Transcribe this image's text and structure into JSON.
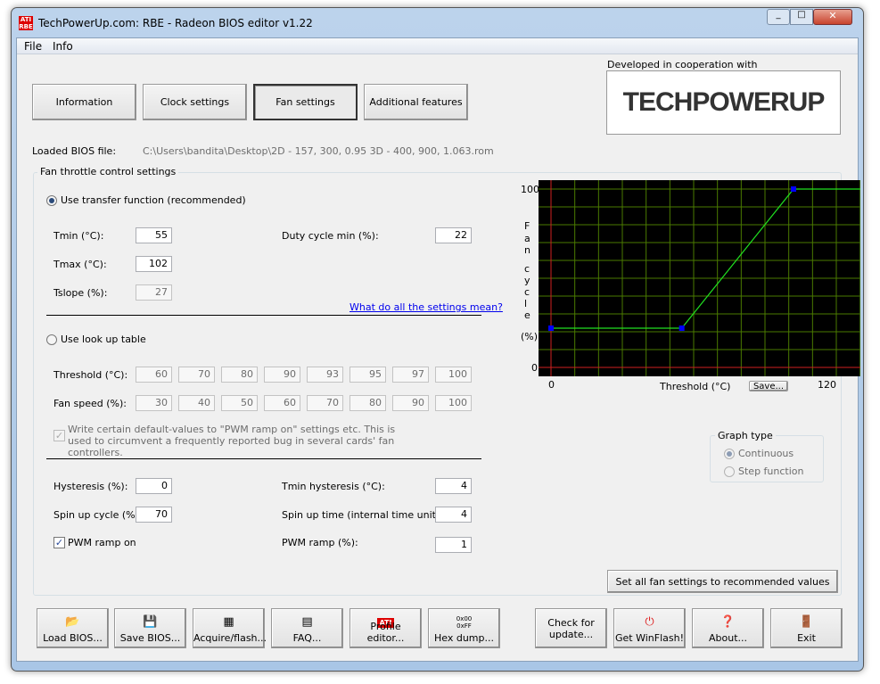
{
  "window": {
    "title": "TechPowerUp.com: RBE - Radeon BIOS editor v1.22",
    "app_icon": "ati-rbe-icon"
  },
  "menu": [
    "File",
    "Info"
  ],
  "tabs": [
    {
      "label": "Information"
    },
    {
      "label": "Clock settings"
    },
    {
      "label": "Fan settings",
      "active": true
    },
    {
      "label": "Additional features"
    }
  ],
  "sponsor": {
    "caption": "Developed in cooperation with",
    "logo_text": "TECHPOWERUP"
  },
  "bios": {
    "label": "Loaded BIOS file:",
    "path": "C:\\Users\\bandita\\Desktop\\2D - 157, 300, 0.95 3D - 400, 900, 1.063.rom"
  },
  "fan": {
    "group_title": "Fan throttle control settings",
    "transfer_radio": "Use transfer function (recommended)",
    "tmin_label": "Tmin (°C):",
    "tmin": "55",
    "tmax_label": "Tmax (°C):",
    "tmax": "102",
    "tslope_label": "Tslope (%):",
    "tslope": "27",
    "duty_min_label": "Duty cycle min (%):",
    "duty_min": "22",
    "help_link": "What do all the settings mean?",
    "lut_radio": "Use look up table",
    "threshold_label": "Threshold (°C):",
    "thresholds": [
      "60",
      "70",
      "80",
      "90",
      "93",
      "95",
      "97",
      "100"
    ],
    "fanspeed_label": "Fan speed (%):",
    "fanspeeds": [
      "30",
      "40",
      "50",
      "60",
      "70",
      "80",
      "90",
      "100"
    ],
    "default_values_check": "Write certain default-values to \"PWM ramp on\" settings etc. This is used to circumvent a frequently reported bug in several cards' fan controllers.",
    "hysteresis_label": "Hysteresis (%):",
    "hysteresis": "0",
    "tmin_hyst_label": "Tmin hysteresis (°C):",
    "tmin_hyst": "4",
    "spinup_cycle_label": "Spin up cycle (%):",
    "spinup_cycle": "70",
    "spinup_time_label": "Spin up time (internal time units):",
    "spinup_time": "4",
    "pwm_ramp_on_label": "PWM ramp on",
    "pwm_ramp_on": true,
    "pwm_ramp_label": "PWM ramp (%):",
    "pwm_ramp": "1",
    "graph_type": {
      "title": "Graph type",
      "options": [
        "Continuous",
        "Step function"
      ],
      "selected": "Continuous"
    },
    "recommended_button": "Set all fan settings to recommended values",
    "save_button": "Save..."
  },
  "chart_data": {
    "type": "line",
    "xlabel": "Threshold (°C)",
    "ylabel": [
      "F",
      "a",
      "n",
      "c",
      "y",
      "c",
      "l",
      "e",
      "(%)"
    ],
    "xlim": [
      0,
      120
    ],
    "ylim": [
      0,
      100
    ],
    "x_ticks": [
      "0",
      "120"
    ],
    "y_ticks": [
      "100",
      "0"
    ],
    "grid": true,
    "colors": {
      "background": "#000000",
      "grid": "#4a7a00",
      "axis": "#d02020",
      "line": "#20e020",
      "point": "#0000ff"
    },
    "points": [
      {
        "x": 0,
        "y": 22
      },
      {
        "x": 55,
        "y": 22
      },
      {
        "x": 102,
        "y": 100
      }
    ]
  },
  "toolbar": [
    {
      "label": "Load BIOS...",
      "icon": "open-folder-icon"
    },
    {
      "label": "Save BIOS...",
      "icon": "floppy-disk-icon"
    },
    {
      "label": "Acquire/flash...",
      "icon": "chip-icon"
    },
    {
      "label": "FAQ...",
      "icon": "document-icon"
    },
    {
      "label": "Profile editor...",
      "icon": "ati-logo-icon"
    },
    {
      "label": "Hex dump...",
      "icon": "hex-icon"
    },
    {
      "label": "Check for update...",
      "icon": ""
    },
    {
      "label": "Get WinFlash!",
      "icon": "power-icon"
    },
    {
      "label": "About...",
      "icon": "help-icon"
    },
    {
      "label": "Exit",
      "icon": "exit-door-icon"
    }
  ]
}
